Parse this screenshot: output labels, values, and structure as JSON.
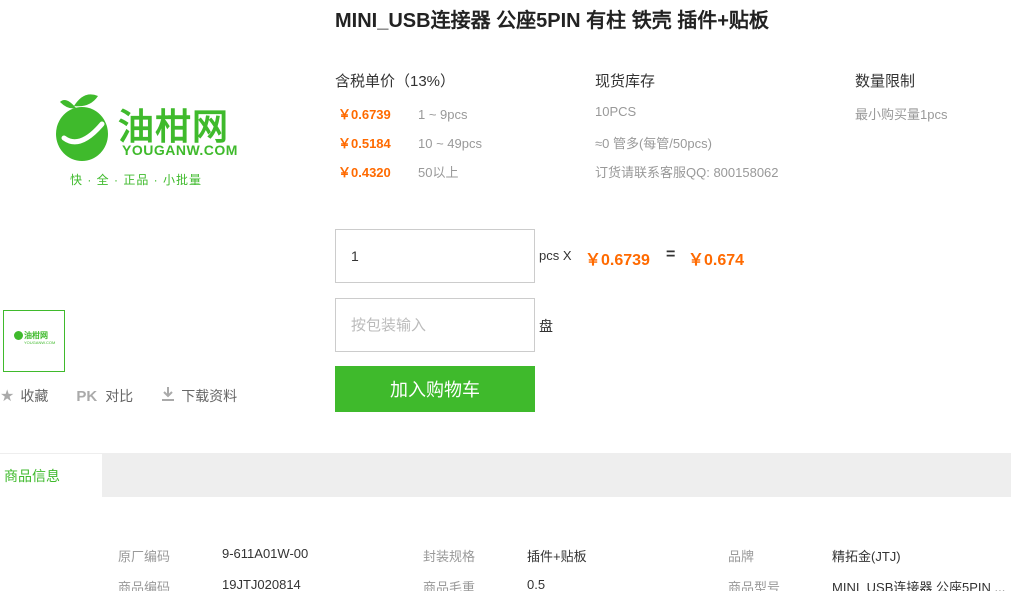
{
  "product": {
    "title": "MINI_USB连接器 公座5PIN 有柱 铁壳 插件+贴板"
  },
  "logo": {
    "name_cn": "油柑网",
    "name_en": "YOUGANW.COM",
    "tagline": "快 · 全 · 正品 · 小批量"
  },
  "pricing": {
    "header_price": "含税单价（13%）",
    "header_stock": "现货库存",
    "header_limit": "数量限制",
    "tiers": [
      {
        "price": "￥0.6739",
        "range": "1 ~ 9pcs"
      },
      {
        "price": "￥0.5184",
        "range": "10 ~ 49pcs"
      },
      {
        "price": "￥0.4320",
        "range": "50以上"
      }
    ],
    "stock_lines": [
      "10PCS",
      "≈0 管多(每管/50pcs)",
      "订货请联系客服QQ: 800158062"
    ],
    "limit_text": "最小购买量1pcs"
  },
  "order": {
    "quantity": "1",
    "pcs_label": "pcs X",
    "unit_price": "￥0.6739",
    "equals": "=",
    "total": "￥0.674",
    "pack_placeholder": "按包装输入",
    "pack_unit": "盘",
    "add_to_cart": "加入购物车"
  },
  "actions": {
    "favorite": "收藏",
    "compare_badge": "PK",
    "compare": "对比",
    "download": "下载资料"
  },
  "tabs": {
    "info": "商品信息"
  },
  "specs": [
    {
      "k1": "原厂编码",
      "v1": "9-611A01W-00",
      "k2": "封装规格",
      "v2": "插件+贴板",
      "k3": "品牌",
      "v3": "精拓金(JTJ)"
    },
    {
      "k1": "商品编码",
      "v1": "19JTJ020814",
      "k2": "商品毛重",
      "v2": "0.5",
      "k3": "商品型号",
      "v3": "MINI_USB连接器 公座5PIN ..."
    }
  ],
  "colors": {
    "brand_green": "#3fba2c",
    "price_orange": "#ff6a00"
  }
}
